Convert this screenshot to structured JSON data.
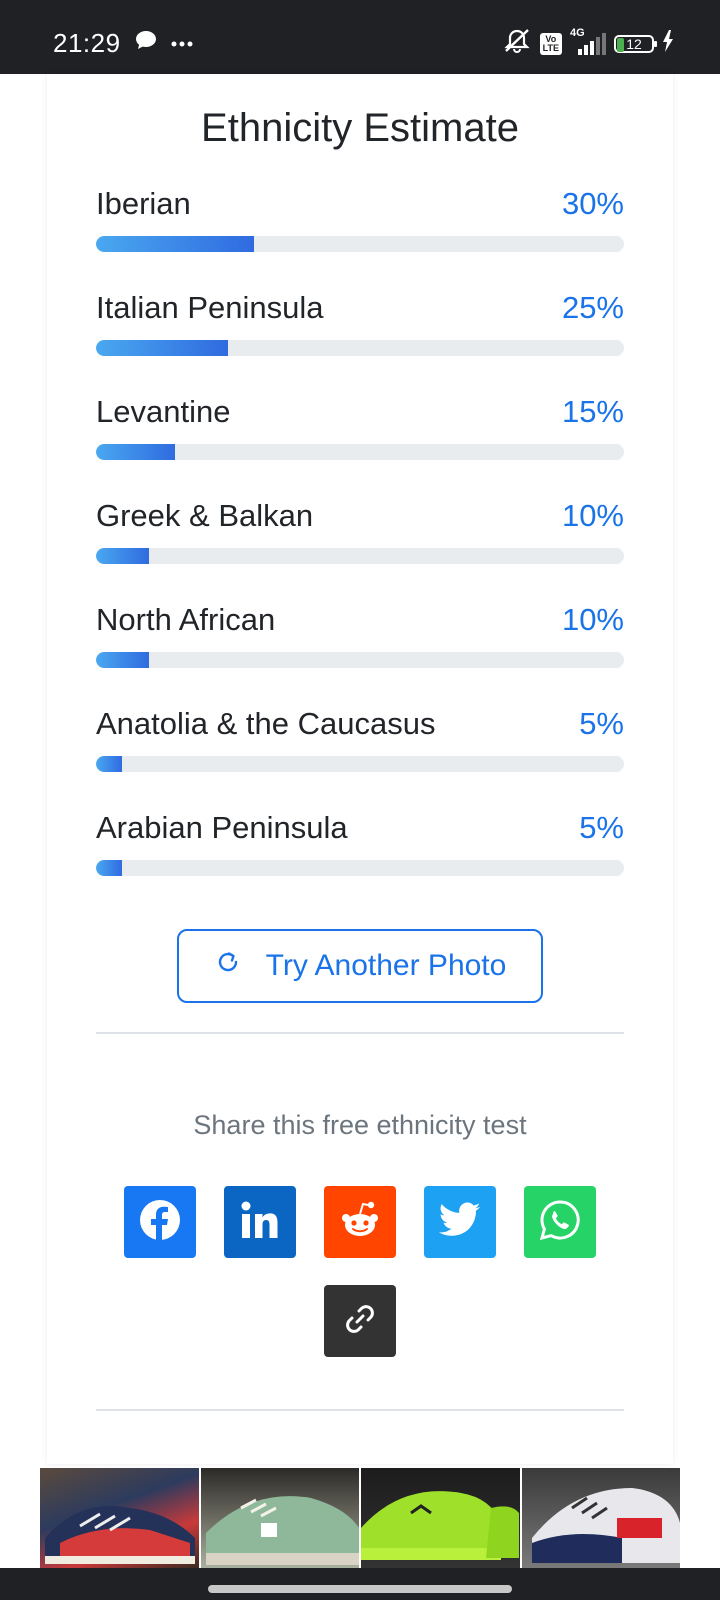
{
  "status_bar": {
    "time": "21:29",
    "network": "4G",
    "lte": "Vo\nLTE",
    "battery": "12",
    "icons": [
      "chat-bubble-icon",
      "more-dots-icon",
      "mute-icon",
      "volte-icon",
      "signal-icon",
      "battery-icon",
      "charging-icon"
    ]
  },
  "card": {
    "title": "Ethnicity Estimate",
    "results": [
      {
        "label": "Iberian",
        "percent_text": "30%",
        "value": 30
      },
      {
        "label": "Italian Peninsula",
        "percent_text": "25%",
        "value": 25
      },
      {
        "label": "Levantine",
        "percent_text": "15%",
        "value": 15
      },
      {
        "label": "Greek & Balkan",
        "percent_text": "10%",
        "value": 10
      },
      {
        "label": "North African",
        "percent_text": "10%",
        "value": 10
      },
      {
        "label": "Anatolia & the Caucasus",
        "percent_text": "5%",
        "value": 5
      },
      {
        "label": "Arabian Peninsula",
        "percent_text": "5%",
        "value": 5
      }
    ],
    "try_button_label": "Try Another Photo",
    "share_text": "Share this free ethnicity test",
    "share_buttons": [
      {
        "name": "facebook",
        "icon": "facebook-icon",
        "color": "#1877f2"
      },
      {
        "name": "linkedin",
        "icon": "linkedin-icon",
        "color": "#0a66c2"
      },
      {
        "name": "reddit",
        "icon": "reddit-icon",
        "color": "#ff4500"
      },
      {
        "name": "twitter",
        "icon": "twitter-icon",
        "color": "#1da1f2"
      },
      {
        "name": "whatsapp",
        "icon": "whatsapp-icon",
        "color": "#25d366"
      },
      {
        "name": "copy-link",
        "icon": "link-icon",
        "color": "#333333"
      }
    ]
  },
  "colors": {
    "accent": "#1a73e8",
    "bar_track": "#e9ecef",
    "bar_fill_start": "#4aa8f0",
    "bar_fill_end": "#2f6be0"
  },
  "ad_strip": {
    "tiles": [
      "sneaker-ad-image",
      "sneaker-ad-image",
      "sneaker-ad-image",
      "sneaker-ad-image"
    ]
  }
}
